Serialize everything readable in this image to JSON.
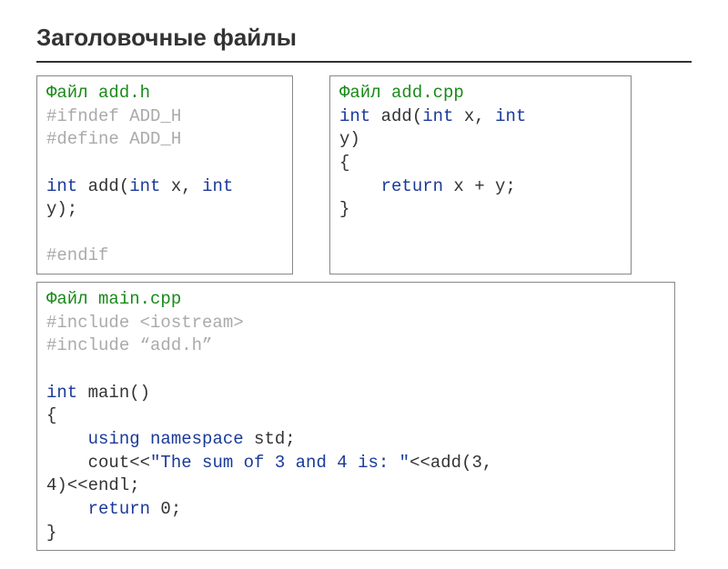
{
  "title": "Заголовочные файлы",
  "file1": {
    "label_file": "Файл ",
    "filename": "add.h",
    "l2": "#ifndef ADD_H",
    "l3": "#define ADD_H",
    "blank": "",
    "l5_int": "int",
    "l5_add": " add(",
    "l5_int2": "int",
    "l5_x": " x, ",
    "l5_int3": "int",
    "l6": "y);",
    "l8": "#endif"
  },
  "file2": {
    "label_file": "Файл ",
    "filename": "add.cpp",
    "l2_int": "int",
    "l2_add": " add(",
    "l2_int2": "int",
    "l2_x": " x, ",
    "l2_int3": "int",
    "l3": "y)",
    "l4": "{",
    "l5_pad": "    ",
    "l5_return": "return",
    "l5_rest": " x + y;",
    "l6": "}"
  },
  "file3": {
    "label_file": "Файл ",
    "filename": "main.cpp",
    "l2": "#include <iostream>",
    "l3": "#include “add.h”",
    "blank": "",
    "l5_int": "int",
    "l5_main": " main()",
    "l6": "{",
    "l7_pad": "    ",
    "l7_using": "using",
    "l7_sp": " ",
    "l7_namespace": "namespace",
    "l7_std": " std;",
    "l8_pad": "    ",
    "l8_cout": "cout<<",
    "l8_str": "\"The sum of 3 and 4 is: \"",
    "l8_addcall": "<<add(3,",
    "l9": "4)<<endl;",
    "l10_pad": "    ",
    "l10_return": "return",
    "l10_zero": " 0;",
    "l11": "}"
  }
}
